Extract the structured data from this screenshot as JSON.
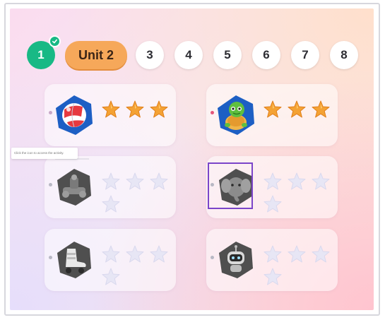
{
  "nav": {
    "completed_unit": "1",
    "current_unit": "Unit 2",
    "units": [
      "3",
      "4",
      "5",
      "6",
      "7",
      "8"
    ]
  },
  "tooltip": {
    "text": "Click the icon to access the activity."
  },
  "activities": [
    {
      "icon": "beach-ball-icon",
      "state": "completed",
      "stars_earned": 3,
      "stars_total": 3
    },
    {
      "icon": "turtle-icon",
      "state": "completed",
      "stars_earned": 3,
      "stars_total": 3
    },
    {
      "icon": "robot-arm-icon",
      "state": "locked",
      "stars_earned": 0,
      "stars_total": 4
    },
    {
      "icon": "elephant-icon",
      "state": "selected",
      "stars_earned": 0,
      "stars_total": 4
    },
    {
      "icon": "roller-skate-icon",
      "state": "locked",
      "stars_earned": 0,
      "stars_total": 4
    },
    {
      "icon": "robot-icon",
      "state": "locked",
      "stars_earned": 0,
      "stars_total": 4
    }
  ],
  "colors": {
    "completed_green": "#18b985",
    "unit_pill": "#f6a85a",
    "star_gold": "#f4a234",
    "star_empty": "#e7e6f5",
    "badge_blue": "#1d5fc4",
    "badge_gray": "#5a5a5a",
    "selection_outline": "#7b45c9"
  }
}
